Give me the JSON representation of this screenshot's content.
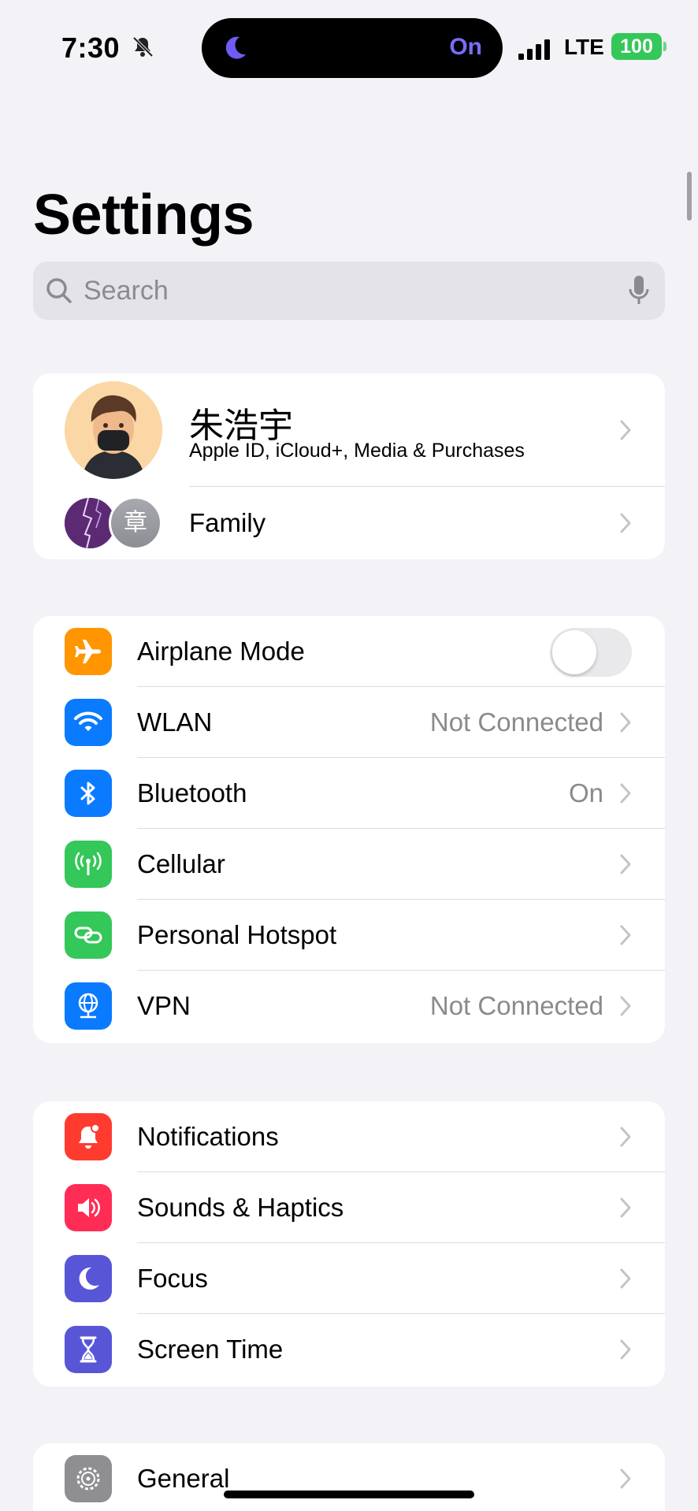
{
  "status_bar": {
    "time": "7:30",
    "focus_state": "On",
    "network": "LTE",
    "battery": "100",
    "colors": {
      "focus": "#7b6cf6",
      "battery": "#34c759"
    }
  },
  "header": {
    "title": "Settings"
  },
  "search": {
    "placeholder": "Search"
  },
  "account": {
    "name": "朱浩宇",
    "subtitle": "Apple ID, iCloud+, Media & Purchases",
    "family_label": "Family",
    "family_member_initial": "章"
  },
  "connectivity": {
    "airplane_mode": {
      "label": "Airplane Mode",
      "enabled": false,
      "icon": "airplane-icon",
      "color": "#ff9500"
    },
    "wlan": {
      "label": "WLAN",
      "value": "Not Connected",
      "icon": "wifi-icon",
      "color": "#0a7aff"
    },
    "bluetooth": {
      "label": "Bluetooth",
      "value": "On",
      "icon": "bluetooth-icon",
      "color": "#0a7aff"
    },
    "cellular": {
      "label": "Cellular",
      "icon": "cellular-icon",
      "color": "#34c759"
    },
    "hotspot": {
      "label": "Personal Hotspot",
      "icon": "hotspot-icon",
      "color": "#34c759"
    },
    "vpn": {
      "label": "VPN",
      "value": "Not Connected",
      "icon": "vpn-globe-icon",
      "color": "#0a7aff"
    }
  },
  "attention": {
    "notifications": {
      "label": "Notifications",
      "icon": "notification-bell-icon",
      "color": "#ff3b30"
    },
    "sounds": {
      "label": "Sounds & Haptics",
      "icon": "speaker-icon",
      "color": "#ff2d55"
    },
    "focus": {
      "label": "Focus",
      "icon": "moon-icon",
      "color": "#5856d6"
    },
    "screen_time": {
      "label": "Screen Time",
      "icon": "hourglass-icon",
      "color": "#5856d6"
    }
  },
  "system": {
    "general": {
      "label": "General",
      "icon": "gear-icon",
      "color": "#8e8e93"
    }
  }
}
